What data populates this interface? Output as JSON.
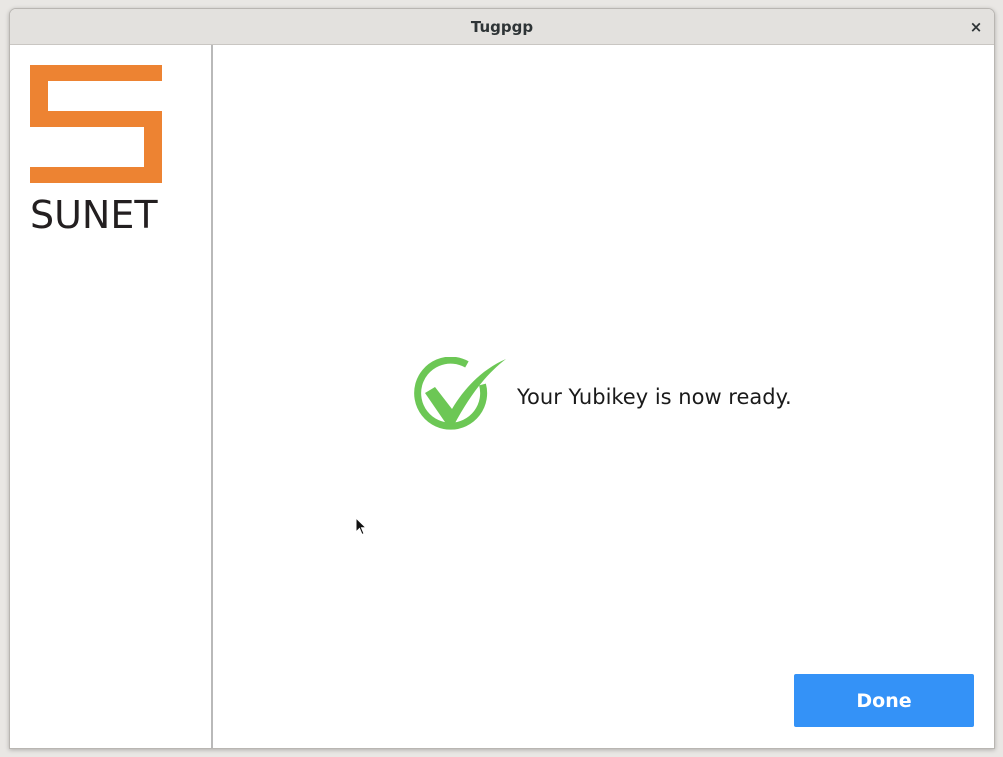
{
  "window": {
    "title": "Tugpgp",
    "close_label": "×"
  },
  "sidebar": {
    "logo_text": "SUNET",
    "logo_color": "#ed8332"
  },
  "main": {
    "status_icon": "check-circle-icon",
    "status_color": "#6cc755",
    "status_message": "Your Yubikey is now ready.",
    "done_label": "Done",
    "accent_color": "#3492f7"
  }
}
